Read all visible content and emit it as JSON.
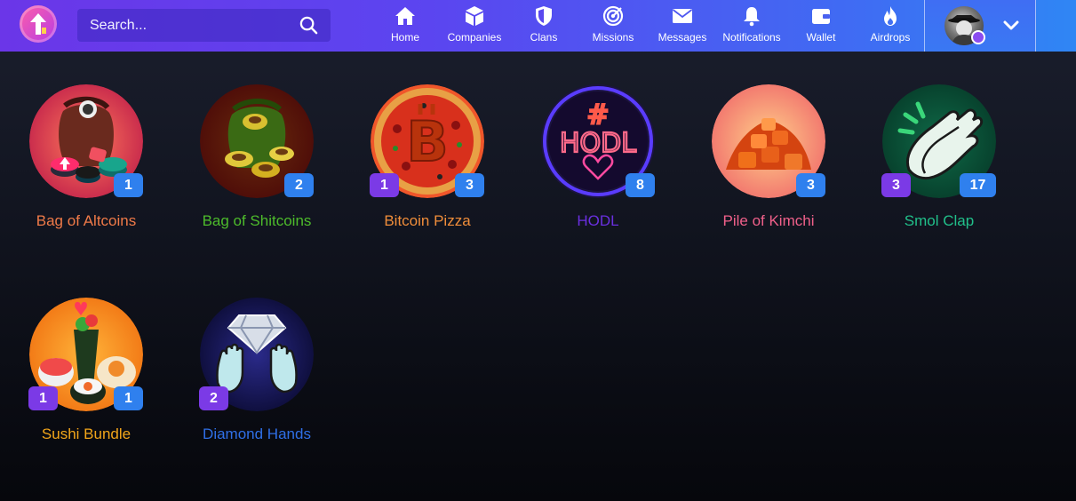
{
  "search": {
    "placeholder": "Search..."
  },
  "nav": [
    {
      "label": "Home",
      "icon": "home-icon"
    },
    {
      "label": "Companies",
      "icon": "cube-icon"
    },
    {
      "label": "Clans",
      "icon": "shield-icon"
    },
    {
      "label": "Missions",
      "icon": "target-icon"
    },
    {
      "label": "Messages",
      "icon": "envelope-icon"
    },
    {
      "label": "Notifications",
      "icon": "bell-icon"
    },
    {
      "label": "Wallet",
      "icon": "wallet-icon"
    },
    {
      "label": "Airdrops",
      "icon": "flame-icon"
    }
  ],
  "colors": {
    "count_blue": "#2f80ee",
    "count_purple": "#7b3ae6"
  },
  "badges": [
    {
      "name": "Bag of Altcoins",
      "color": "#f07a48",
      "count_right": "1",
      "count_left": ""
    },
    {
      "name": "Bag of Shitcoins",
      "color": "#4dbb2b",
      "count_right": "2",
      "count_left": ""
    },
    {
      "name": "Bitcoin Pizza",
      "color": "#f08d3a",
      "count_right": "3",
      "count_left": "1"
    },
    {
      "name": "HODL",
      "color": "#6a2fe0",
      "count_right": "8",
      "count_left": ""
    },
    {
      "name": "Pile of Kimchi",
      "color": "#f0608a",
      "count_right": "3",
      "count_left": ""
    },
    {
      "name": "Smol Clap",
      "color": "#21c08a",
      "count_right": "17",
      "count_left": "3"
    },
    {
      "name": "Sushi Bundle",
      "color": "#f2a51a",
      "count_right": "1",
      "count_left": "1"
    },
    {
      "name": "Diamond Hands",
      "color": "#2f6fe6",
      "count_right": "",
      "count_left": "2"
    }
  ]
}
